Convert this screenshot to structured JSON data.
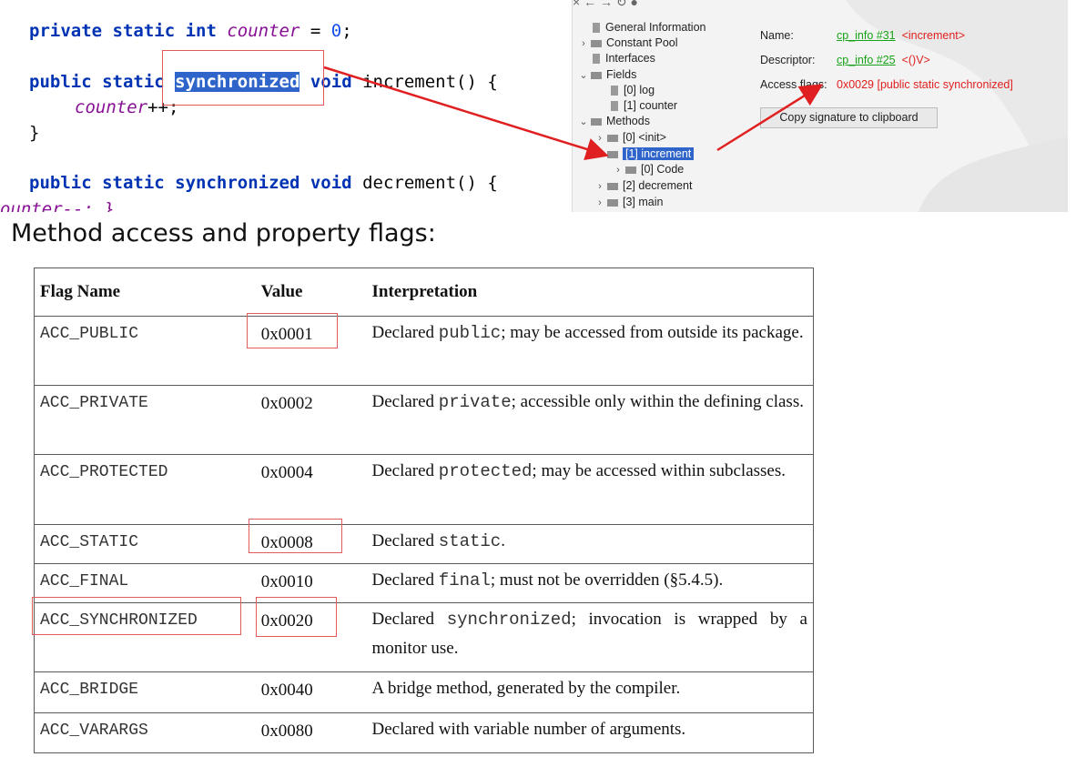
{
  "code": {
    "line1": {
      "kw": "private static int",
      "field": "counter",
      "rest": " = ",
      "num": "0",
      "end": ";"
    },
    "line2": {
      "kw1": "public static",
      "kw_pre": " ",
      "selected": "synchronized",
      "kw2": " void",
      "rest": " increment() {"
    },
    "line3": {
      "field": "counter",
      "rest": "++;"
    },
    "line4": "}",
    "line5": {
      "kw1": "public",
      "kw2": " static synchronized void",
      "rest": " decrement() {"
    },
    "line6": "ounter--; }"
  },
  "jclasslib": {
    "toolbar": "×  ←  →  ↻  ●",
    "tree": {
      "general": "General Information",
      "constant_pool": "Constant Pool",
      "interfaces": "Interfaces",
      "fields": "Fields",
      "field0": "[0] log",
      "field1": "[1] counter",
      "methods": "Methods",
      "method0": "[0] <init>",
      "method1": "[1] increment",
      "code": "[0] Code",
      "method2": "[2] decrement",
      "method3": "[3] main"
    },
    "detail": {
      "name_label": "Name:",
      "name_link": "cp_info #31",
      "name_value": "<increment>",
      "descriptor_label": "Descriptor:",
      "descriptor_link": "cp_info #25",
      "descriptor_value": "<()V>",
      "access_label": "Access flags:",
      "access_value": "0x0029 [public static synchronized]",
      "copy_button": "Copy signature to clipboard"
    }
  },
  "heading": "Method access and property flags:",
  "table": {
    "headers": [
      "Flag Name",
      "Value",
      "Interpretation"
    ],
    "rows": [
      {
        "name": "ACC_PUBLIC",
        "value": "0x0001",
        "pre": "Declared ",
        "code": "public",
        "post": "; may be accessed from outside its package."
      },
      {
        "name": "ACC_PRIVATE",
        "value": "0x0002",
        "pre": "Declared ",
        "code": "private",
        "post": "; accessible only within the defining class."
      },
      {
        "name": "ACC_PROTECTED",
        "value": "0x0004",
        "pre": "Declared ",
        "code": "protected",
        "post": "; may be accessed within subclasses."
      },
      {
        "name": "ACC_STATIC",
        "value": "0x0008",
        "pre": "Declared ",
        "code": "static",
        "post": "."
      },
      {
        "name": "ACC_FINAL",
        "value": "0x0010",
        "pre": "Declared ",
        "code": "final",
        "post": "; must not be overridden (§5.4.5)."
      },
      {
        "name": "ACC_SYNCHRONIZED",
        "value": "0x0020",
        "pre": "Declared ",
        "code": "synchronized",
        "post": "; invocation is wrapped by a monitor use."
      },
      {
        "name": "ACC_BRIDGE",
        "value": "0x0040",
        "pre": "A bridge method, generated by the compiler.",
        "code": "",
        "post": ""
      },
      {
        "name": "ACC_VARARGS",
        "value": "0x0080",
        "pre": "Declared with variable number of arguments.",
        "code": "",
        "post": ""
      }
    ]
  },
  "colors": {
    "annotation_red": "#e35a5a",
    "selection_blue": "#2f65ca",
    "keyword_blue": "#0033b3",
    "field_purple": "#871094"
  }
}
